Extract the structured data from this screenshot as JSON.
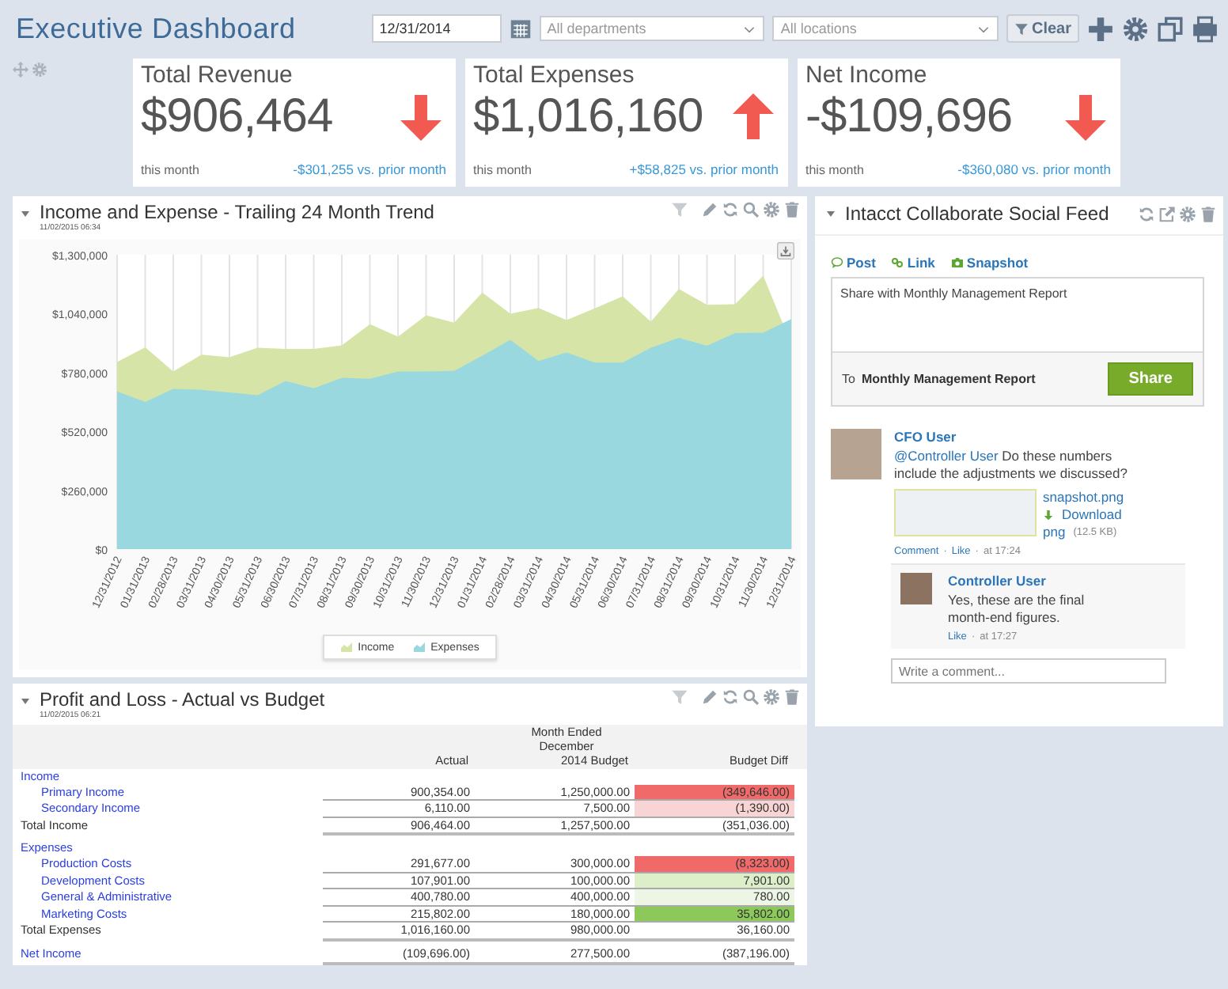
{
  "header": {
    "title": "Executive Dashboard",
    "date": "12/31/2014",
    "department_filter": {
      "placeholder": "All departments"
    },
    "location_filter": {
      "placeholder": "All locations"
    },
    "clear_button": "Clear"
  },
  "kpis": [
    {
      "title": "Total Revenue",
      "value": "$906,464",
      "kind": "down",
      "period": "this month",
      "change": "-$301,255 vs. prior month"
    },
    {
      "title": "Total Expenses",
      "value": "$1,016,160",
      "kind": "up",
      "period": "this month",
      "change": "+$58,825 vs. prior month"
    },
    {
      "title": "Net Income",
      "value": "-$109,696",
      "kind": "down",
      "period": "this month",
      "change": "-$360,080 vs. prior month"
    }
  ],
  "trend_panel": {
    "title": "Income and Expense - Trailing 24 Month Trend",
    "timestamp": "11/02/2015 06:34",
    "chart_data": {
      "type": "area",
      "stacked": false,
      "categories": [
        "12/31/2012",
        "01/31/2013",
        "02/28/2013",
        "03/31/2013",
        "04/30/2013",
        "05/31/2013",
        "06/30/2013",
        "07/31/2013",
        "08/31/2013",
        "09/30/2013",
        "10/31/2013",
        "11/30/2013",
        "12/31/2013",
        "01/31/2014",
        "02/28/2014",
        "03/31/2014",
        "04/30/2014",
        "05/31/2014",
        "06/30/2014",
        "07/31/2014",
        "08/31/2014",
        "09/30/2014",
        "10/31/2014",
        "11/30/2014",
        "12/31/2014"
      ],
      "ylim": [
        0,
        1300000
      ],
      "yticks": [
        {
          "value": 0,
          "label": "$0"
        },
        {
          "value": 260000,
          "label": "$260,000"
        },
        {
          "value": 520000,
          "label": "$520,000"
        },
        {
          "value": 780000,
          "label": "$780,000"
        },
        {
          "value": 1040000,
          "label": "$1,040,000"
        },
        {
          "value": 1300000,
          "label": "$1,300,000"
        }
      ],
      "series": [
        {
          "name": "Income",
          "color": "#d6e4a8",
          "values": [
            826000,
            891000,
            785000,
            859000,
            847000,
            889000,
            884000,
            884000,
            900000,
            993000,
            938000,
            1033000,
            1000000,
            1133000,
            1040000,
            1065000,
            1012000,
            1063000,
            1116000,
            1005000,
            1149000,
            1079000,
            1082000,
            1207000,
            906000
          ]
        },
        {
          "name": "Expenses",
          "color": "#9ad8df",
          "values": [
            696000,
            650000,
            708000,
            703000,
            692000,
            680000,
            743000,
            710000,
            757000,
            752000,
            785000,
            785000,
            787000,
            854000,
            924000,
            831000,
            868000,
            824000,
            824000,
            889000,
            933000,
            898000,
            954000,
            956000,
            1016000
          ]
        }
      ]
    }
  },
  "pnl_panel": {
    "title": "Profit and Loss - Actual vs Budget",
    "timestamp": "11/02/2015 06:21",
    "period_header": "Month Ended December",
    "columns": [
      "Actual",
      "2014 Budget",
      "Budget Diff"
    ],
    "rows": [
      {
        "kind": "section",
        "label": "Income"
      },
      {
        "kind": "item",
        "label": "Primary Income",
        "actual": "900,354.00",
        "budget": "1,250,000.00",
        "diff": "(349,646.00)",
        "color": "#f06a6a"
      },
      {
        "kind": "item",
        "label": "Secondary Income",
        "actual": "6,110.00",
        "budget": "7,500.00",
        "diff": "(1,390.00)",
        "color": "#f8d4d4"
      },
      {
        "kind": "total",
        "label": "Total Income",
        "actual": "906,464.00",
        "budget": "1,257,500.00",
        "diff": "(351,036.00)"
      },
      {
        "kind": "section",
        "label": "Expenses"
      },
      {
        "kind": "item",
        "label": "Production Costs",
        "actual": "291,677.00",
        "budget": "300,000.00",
        "diff": "(8,323.00)",
        "color": "#f06a6a"
      },
      {
        "kind": "item",
        "label": "Development Costs",
        "actual": "107,901.00",
        "budget": "100,000.00",
        "diff": "7,901.00",
        "color": "#dcefc9"
      },
      {
        "kind": "item",
        "label": "General & Administrative",
        "actual": "400,780.00",
        "budget": "400,000.00",
        "diff": "780.00",
        "color": "#edf6e4"
      },
      {
        "kind": "item",
        "label": "Marketing Costs",
        "actual": "215,802.00",
        "budget": "180,000.00",
        "diff": "35,802.00",
        "color": "#8cc95a"
      },
      {
        "kind": "total",
        "label": "Total Expenses",
        "actual": "1,016,160.00",
        "budget": "980,000.00",
        "diff": "36,160.00"
      },
      {
        "kind": "net",
        "label": "Net Income",
        "actual": "(109,696.00)",
        "budget": "277,500.00",
        "diff": "(387,196.00)"
      }
    ]
  },
  "feed": {
    "title": "Intacct Collaborate Social Feed",
    "actions": [
      {
        "kind": "post",
        "label": "Post"
      },
      {
        "kind": "link",
        "label": "Link"
      },
      {
        "kind": "snapshot",
        "label": "Snapshot"
      }
    ],
    "composer": {
      "value": "Share with Monthly Management Report",
      "to_label": "To",
      "to_value": "Monthly Management Report",
      "button": "Share"
    },
    "post": {
      "author": "CFO User",
      "mention": "@Controller User",
      "text": "Do these numbers include the adjustments we discussed?",
      "attachment": {
        "name": "snapshot.png",
        "download": "Download",
        "type": "png",
        "size": "(12.5 KB)"
      },
      "meta": [
        {
          "kind": "link",
          "text": "Comment"
        },
        {
          "kind": "sep",
          "text": "·"
        },
        {
          "kind": "link",
          "text": "Like"
        },
        {
          "kind": "sep",
          "text": "·"
        },
        {
          "kind": "time",
          "text": "at 17:24"
        }
      ],
      "reply": {
        "author": "Controller User",
        "text": "Yes, these are the final month-end figures.",
        "meta": [
          {
            "kind": "link",
            "text": "Like"
          },
          {
            "kind": "sep",
            "text": "·"
          },
          {
            "kind": "time",
            "text": "at 17:27"
          }
        ]
      },
      "comment_field": {
        "placeholder": "Write a comment..."
      }
    }
  }
}
